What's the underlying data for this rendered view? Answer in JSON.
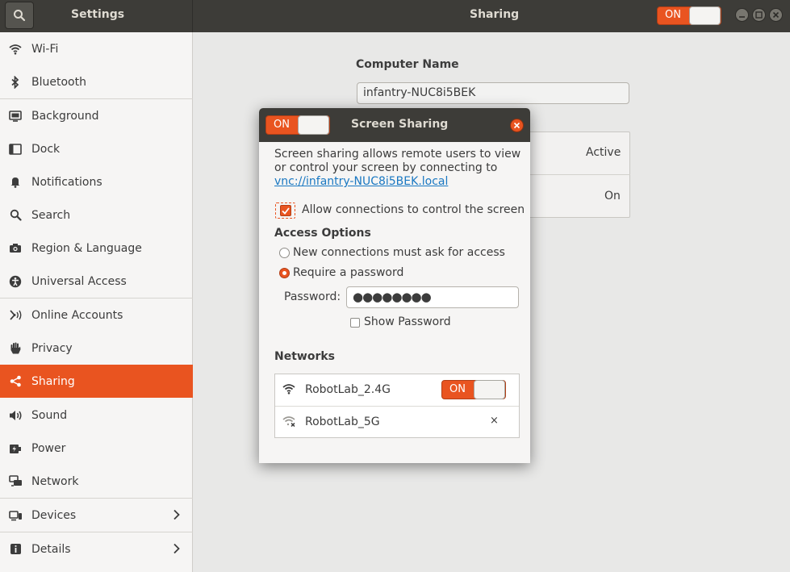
{
  "header": {
    "settings_title": "Settings",
    "panel_title": "Sharing",
    "sharing_switch_label": "ON"
  },
  "sidebar": {
    "items": [
      {
        "label": "Wi-Fi",
        "icon": "wifi-icon"
      },
      {
        "label": "Bluetooth",
        "icon": "bluetooth-icon"
      },
      {
        "label": "Background",
        "icon": "background-icon"
      },
      {
        "label": "Dock",
        "icon": "dock-icon"
      },
      {
        "label": "Notifications",
        "icon": "bell-icon"
      },
      {
        "label": "Search",
        "icon": "search-icon"
      },
      {
        "label": "Region & Language",
        "icon": "camera-icon"
      },
      {
        "label": "Universal Access",
        "icon": "accessibility-icon"
      },
      {
        "label": "Online Accounts",
        "icon": "online-accounts-icon"
      },
      {
        "label": "Privacy",
        "icon": "hand-icon"
      },
      {
        "label": "Sharing",
        "icon": "share-icon"
      },
      {
        "label": "Sound",
        "icon": "speaker-icon"
      },
      {
        "label": "Power",
        "icon": "power-icon"
      },
      {
        "label": "Network",
        "icon": "network-icon"
      },
      {
        "label": "Devices",
        "icon": "devices-icon"
      },
      {
        "label": "Details",
        "icon": "details-icon"
      }
    ],
    "active": "Sharing"
  },
  "main": {
    "computer_name_label": "Computer Name",
    "computer_name_value": "infantry-NUC8i5BEK",
    "services": [
      {
        "status": "Active"
      },
      {
        "status": "On"
      }
    ]
  },
  "dialog": {
    "title": "Screen Sharing",
    "switch_label": "ON",
    "description_text": "Screen sharing allows remote users to view or control your screen by connecting to ",
    "description_link": "vnc://infantry-NUC8i5BEK.local",
    "allow_control_label": "Allow connections to control the screen",
    "allow_control_checked": true,
    "access_options_heading": "Access Options",
    "option_ask": "New connections must ask for access",
    "option_password": "Require a password",
    "selected_option": "Require a password",
    "password_label": "Password:",
    "password_value": "●●●●●●●●",
    "show_password_label": "Show Password",
    "networks_heading": "Networks",
    "networks": [
      {
        "name": "RobotLab_2.4G",
        "switch_label": "ON"
      },
      {
        "name": "RobotLab_5G",
        "remove_symbol": "×"
      }
    ]
  },
  "colors": {
    "accent": "#e95420",
    "header_bg": "#3d3c38",
    "link": "#1a78c2"
  }
}
